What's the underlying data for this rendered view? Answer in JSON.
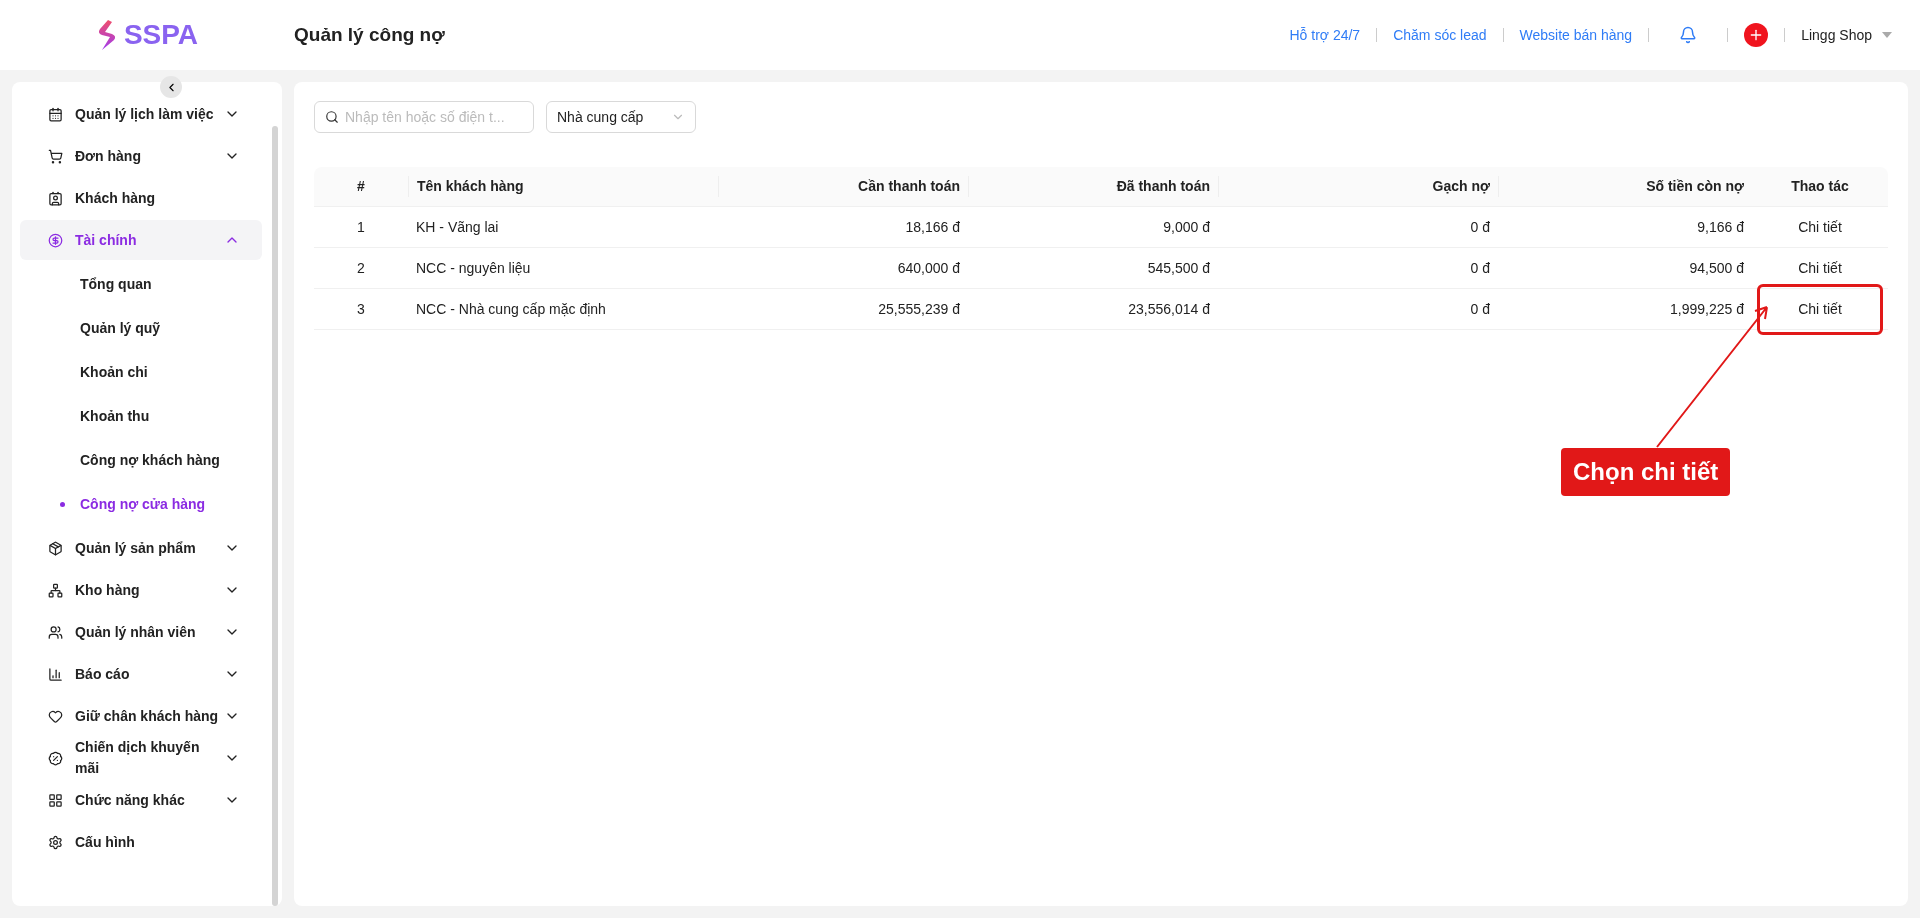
{
  "header": {
    "logo": "SSPA",
    "title": "Quản lý công nợ",
    "links": [
      "Hỗ trợ 24/7",
      "Chăm sóc lead",
      "Website bán hàng"
    ],
    "user": "Lingg Shop"
  },
  "sidebar": {
    "items": [
      {
        "label": "Quản lý lịch làm việc",
        "kind": "group",
        "expanded": false,
        "selected": false
      },
      {
        "label": "Đơn hàng",
        "kind": "group",
        "expanded": false,
        "selected": false
      },
      {
        "label": "Khách hàng",
        "kind": "link",
        "selected": false
      },
      {
        "label": "Tài chính",
        "kind": "group",
        "expanded": true,
        "selected": true,
        "children": [
          {
            "label": "Tổng quan",
            "selected": false
          },
          {
            "label": "Quản lý quỹ",
            "selected": false
          },
          {
            "label": "Khoản chi",
            "selected": false
          },
          {
            "label": "Khoản thu",
            "selected": false
          },
          {
            "label": "Công nợ khách hàng",
            "selected": false
          },
          {
            "label": "Công nợ cửa hàng",
            "selected": true
          }
        ]
      },
      {
        "label": "Quản lý sản phẩm",
        "kind": "group",
        "expanded": false,
        "selected": false
      },
      {
        "label": "Kho hàng",
        "kind": "group",
        "expanded": false,
        "selected": false
      },
      {
        "label": "Quản lý nhân viên",
        "kind": "group",
        "expanded": false,
        "selected": false
      },
      {
        "label": "Báo cáo",
        "kind": "group",
        "expanded": false,
        "selected": false
      },
      {
        "label": "Giữ chân khách hàng",
        "kind": "group",
        "expanded": false,
        "selected": false
      },
      {
        "label": "Chiến dịch khuyến mãi",
        "kind": "group",
        "expanded": false,
        "selected": false
      },
      {
        "label": "Chức năng khác",
        "kind": "group",
        "expanded": false,
        "selected": false
      },
      {
        "label": "Cấu hình",
        "kind": "link",
        "selected": false
      }
    ]
  },
  "filters": {
    "search": {
      "placeholder": "Nhập tên hoặc số điện t..."
    },
    "type_select": {
      "value": "Nhà cung cấp"
    }
  },
  "table": {
    "columns": [
      "#",
      "Tên khách hàng",
      "Cần thanh toán",
      "Đã thanh toán",
      "Gạch nợ",
      "Số tiền còn nợ",
      "Thao tác"
    ],
    "rows": [
      {
        "cells": [
          "1",
          "KH - Vãng lai",
          "18,166 đ",
          "9,000 đ",
          "0 đ",
          "9,166 đ"
        ],
        "action": "Chi tiết",
        "highlighted": false
      },
      {
        "cells": [
          "2",
          "NCC - nguyên liệu",
          "640,000 đ",
          "545,500 đ",
          "0 đ",
          "94,500 đ"
        ],
        "action": "Chi tiết",
        "highlighted": false
      },
      {
        "cells": [
          "3",
          "NCC - Nhà cung cấp mặc định",
          "25,555,239 đ",
          "23,556,014 đ",
          "0 đ",
          "1,999,225 đ"
        ],
        "action": "Chi tiết",
        "highlighted": true
      }
    ]
  },
  "callout": {
    "label": "Chọn chi tiết"
  }
}
